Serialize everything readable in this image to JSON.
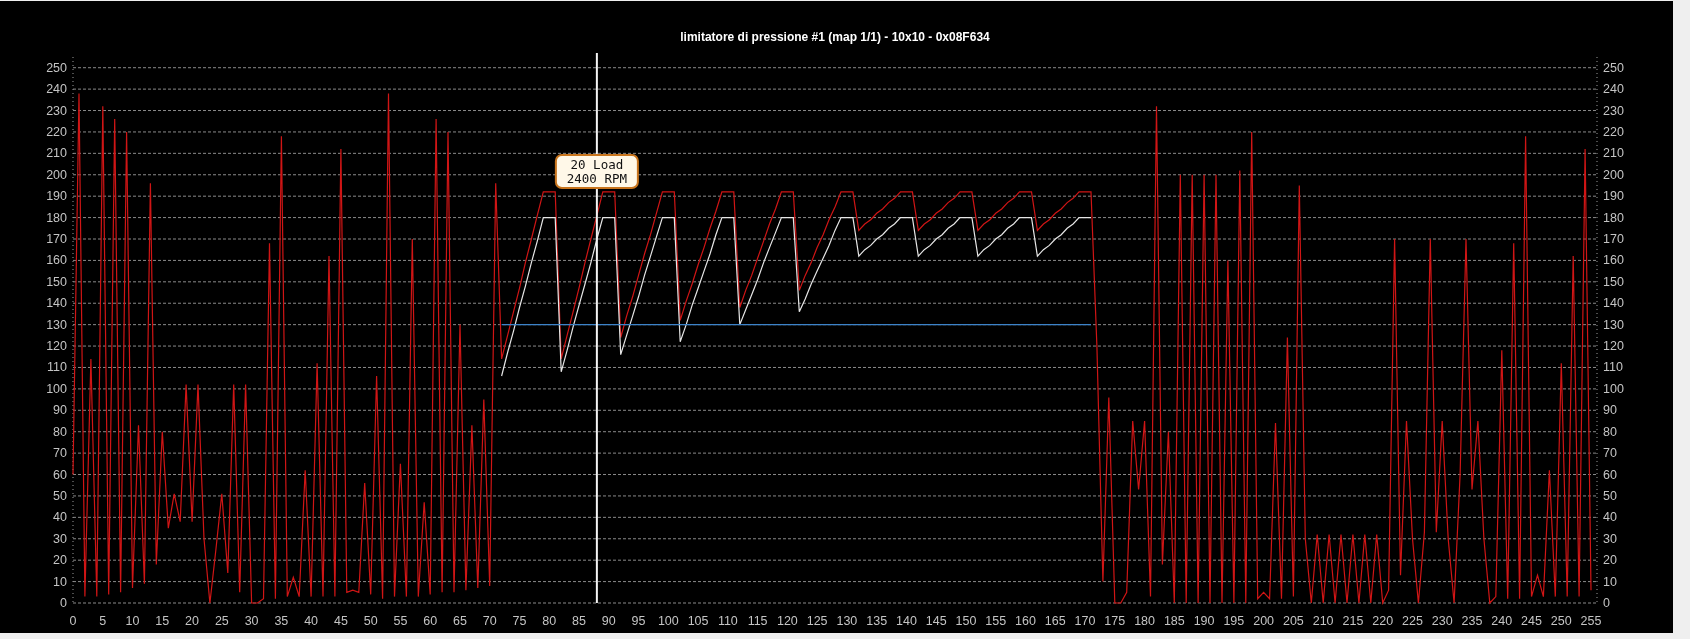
{
  "chart_data": {
    "type": "line",
    "title": "limitatore di pressione #1 (map 1/1) - 10x10 - 0x08F634",
    "grid": true,
    "x": [
      0,
      1,
      2,
      3,
      4,
      5,
      6,
      7,
      8,
      9,
      10,
      11,
      12,
      13,
      14,
      15,
      16,
      17,
      18,
      19,
      20,
      21,
      22,
      23,
      24,
      25,
      26,
      27,
      28,
      29,
      30,
      31,
      32,
      33,
      34,
      35,
      36,
      37,
      38,
      39,
      40,
      41,
      42,
      43,
      44,
      45,
      46,
      47,
      48,
      49,
      50,
      51,
      52,
      53,
      54,
      55,
      56,
      57,
      58,
      59,
      60,
      61,
      62,
      63,
      64,
      65,
      66,
      67,
      68,
      69,
      70,
      71,
      72,
      73,
      74,
      75,
      76,
      77,
      78,
      79,
      80,
      81,
      82,
      83,
      84,
      85,
      86,
      87,
      88,
      89,
      90,
      91,
      92,
      93,
      94,
      95,
      96,
      97,
      98,
      99,
      100,
      101,
      102,
      103,
      104,
      105,
      106,
      107,
      108,
      109,
      110,
      111,
      112,
      113,
      114,
      115,
      116,
      117,
      118,
      119,
      120,
      121,
      122,
      123,
      124,
      125,
      126,
      127,
      128,
      129,
      130,
      131,
      132,
      133,
      134,
      135,
      136,
      137,
      138,
      139,
      140,
      141,
      142,
      143,
      144,
      145,
      146,
      147,
      148,
      149,
      150,
      151,
      152,
      153,
      154,
      155,
      156,
      157,
      158,
      159,
      160,
      161,
      162,
      163,
      164,
      165,
      166,
      167,
      168,
      169,
      170,
      171,
      172,
      173,
      174,
      175,
      176,
      177,
      178,
      179,
      180,
      181,
      182,
      183,
      184,
      185,
      186,
      187,
      188,
      189,
      190,
      191,
      192,
      193,
      194,
      195,
      196,
      197,
      198,
      199,
      200,
      201,
      202,
      203,
      204,
      205,
      206,
      207,
      208,
      209,
      210,
      211,
      212,
      213,
      214,
      215,
      216,
      217,
      218,
      219,
      220,
      221,
      222,
      223,
      224,
      225,
      226,
      227,
      228,
      229,
      230,
      231,
      232,
      233,
      234,
      235,
      236,
      237,
      238,
      239,
      240,
      241,
      242,
      243,
      244,
      245,
      246,
      247,
      248,
      249,
      250,
      251,
      252,
      253,
      254,
      255
    ],
    "xlim": [
      0,
      256
    ],
    "ylim": [
      0,
      255
    ],
    "xticks": [
      0,
      5,
      10,
      15,
      20,
      25,
      30,
      35,
      40,
      45,
      50,
      55,
      60,
      65,
      70,
      75,
      80,
      85,
      90,
      95,
      100,
      105,
      110,
      115,
      120,
      125,
      130,
      135,
      140,
      145,
      150,
      155,
      160,
      165,
      170,
      175,
      180,
      185,
      190,
      195,
      200,
      205,
      210,
      215,
      220,
      225,
      230,
      235,
      240,
      245,
      250,
      255
    ],
    "yticks": [
      0,
      10,
      20,
      30,
      40,
      50,
      60,
      70,
      80,
      90,
      100,
      110,
      120,
      130,
      140,
      150,
      160,
      170,
      180,
      190,
      200,
      210,
      220,
      230,
      240,
      250
    ],
    "series": [
      {
        "color": "#d01515",
        "values": [
          60,
          238,
          3,
          114,
          3,
          232,
          4,
          226,
          5,
          220,
          7,
          83,
          9,
          196,
          18,
          80,
          35,
          51,
          38,
          102,
          38,
          102,
          30,
          0,
          25,
          51,
          14,
          102,
          5,
          102,
          0,
          0,
          2,
          168,
          2,
          218,
          3,
          12,
          3,
          62,
          3,
          112,
          3,
          162,
          3,
          212,
          5,
          6,
          5,
          56,
          4,
          106,
          2,
          238,
          3,
          65,
          3,
          170,
          3,
          47,
          4,
          226,
          5,
          220,
          5,
          130,
          6,
          83,
          7,
          95,
          8,
          196,
          114,
          125,
          136,
          147,
          159,
          170,
          181,
          192,
          192,
          192,
          114,
          125,
          136,
          147,
          159,
          170,
          181,
          192,
          192,
          192,
          124,
          134,
          143,
          153,
          163,
          172,
          182,
          192,
          192,
          192,
          132,
          141,
          149,
          158,
          166,
          175,
          183,
          192,
          192,
          192,
          138,
          146,
          153,
          161,
          169,
          177,
          184,
          192,
          192,
          192,
          146,
          153,
          159,
          166,
          172,
          179,
          185,
          192,
          192,
          192,
          174,
          177,
          179,
          182,
          184,
          187,
          189,
          192,
          192,
          192,
          174,
          177,
          179,
          182,
          184,
          187,
          189,
          192,
          192,
          192,
          174,
          177,
          179,
          182,
          184,
          187,
          189,
          192,
          192,
          192,
          174,
          177,
          179,
          182,
          184,
          187,
          189,
          192,
          192,
          192,
          120,
          10,
          96,
          0,
          0,
          5,
          85,
          53,
          85,
          3,
          232,
          18,
          80,
          0,
          200,
          0,
          200,
          0,
          200,
          0,
          200,
          0,
          160,
          0,
          202,
          0,
          220,
          2,
          5,
          2,
          84,
          2,
          124,
          3,
          195,
          30,
          0,
          32,
          0,
          32,
          0,
          32,
          0,
          32,
          0,
          32,
          0,
          32,
          0,
          6,
          170,
          13,
          85,
          30,
          0,
          33,
          170,
          33,
          85,
          30,
          0,
          60,
          170,
          53,
          85,
          30,
          0,
          3,
          118,
          2,
          168,
          2,
          218,
          3,
          13,
          3,
          62,
          3,
          112,
          3,
          162,
          3,
          212,
          6
        ]
      },
      {
        "color": "#e6e6e6",
        "values": [
          null,
          null,
          null,
          null,
          null,
          null,
          null,
          null,
          null,
          null,
          null,
          null,
          null,
          null,
          null,
          null,
          null,
          null,
          null,
          null,
          null,
          null,
          null,
          null,
          null,
          null,
          null,
          null,
          null,
          null,
          null,
          null,
          null,
          null,
          null,
          null,
          null,
          null,
          null,
          null,
          null,
          null,
          null,
          null,
          null,
          null,
          null,
          null,
          null,
          null,
          null,
          null,
          null,
          null,
          null,
          null,
          null,
          null,
          null,
          null,
          null,
          null,
          null,
          null,
          null,
          null,
          null,
          null,
          null,
          null,
          null,
          null,
          106,
          117,
          127,
          138,
          148,
          159,
          169,
          180,
          180,
          180,
          108,
          118,
          129,
          139,
          149,
          159,
          170,
          180,
          180,
          180,
          116,
          125,
          134,
          143,
          153,
          162,
          171,
          180,
          180,
          180,
          122,
          130,
          139,
          147,
          155,
          163,
          172,
          180,
          180,
          180,
          130,
          137,
          144,
          151,
          159,
          166,
          173,
          180,
          180,
          180,
          136,
          142,
          149,
          155,
          161,
          167,
          174,
          180,
          180,
          180,
          162,
          165,
          167,
          170,
          172,
          175,
          177,
          180,
          180,
          180,
          162,
          165,
          167,
          170,
          172,
          175,
          177,
          180,
          180,
          180,
          162,
          165,
          167,
          170,
          172,
          175,
          177,
          180,
          180,
          180,
          162,
          165,
          167,
          170,
          172,
          175,
          177,
          180,
          180,
          180,
          null,
          null,
          null,
          null,
          null,
          null,
          null,
          null,
          null,
          null,
          null,
          null,
          null,
          null,
          null,
          null,
          null,
          null,
          null,
          null,
          null,
          null,
          null,
          null,
          null,
          null,
          null,
          null,
          null,
          null,
          null,
          null,
          null,
          null,
          null,
          null,
          null,
          null,
          null,
          null,
          null,
          null,
          null,
          null,
          null,
          null,
          null,
          null,
          null,
          null,
          null,
          null,
          null,
          null,
          null,
          null,
          null,
          null,
          null,
          null,
          null,
          null,
          null,
          null,
          null,
          null,
          null,
          null,
          null,
          null,
          null,
          null,
          null,
          null,
          null,
          null,
          null,
          null,
          null,
          null,
          null,
          null,
          null,
          null
        ]
      },
      {
        "color": "#3c82c8",
        "values": [
          null,
          null,
          null,
          null,
          null,
          null,
          null,
          null,
          null,
          null,
          null,
          null,
          null,
          null,
          null,
          null,
          null,
          null,
          null,
          null,
          null,
          null,
          null,
          null,
          null,
          null,
          null,
          null,
          null,
          null,
          null,
          null,
          null,
          null,
          null,
          null,
          null,
          null,
          null,
          null,
          null,
          null,
          null,
          null,
          null,
          null,
          null,
          null,
          null,
          null,
          null,
          null,
          null,
          null,
          null,
          null,
          null,
          null,
          null,
          null,
          null,
          null,
          null,
          null,
          null,
          null,
          null,
          null,
          null,
          null,
          null,
          null,
          130,
          130,
          130,
          130,
          130,
          130,
          130,
          130,
          130,
          130,
          130,
          130,
          130,
          130,
          130,
          130,
          130,
          130,
          130,
          130,
          130,
          130,
          130,
          130,
          130,
          130,
          130,
          130,
          130,
          130,
          130,
          130,
          130,
          130,
          130,
          130,
          130,
          130,
          130,
          130,
          130,
          130,
          130,
          130,
          130,
          130,
          130,
          130,
          130,
          130,
          130,
          130,
          130,
          130,
          130,
          130,
          130,
          130,
          130,
          130,
          130,
          130,
          130,
          130,
          130,
          130,
          130,
          130,
          130,
          130,
          130,
          130,
          130,
          130,
          130,
          130,
          130,
          130,
          130,
          130,
          130,
          130,
          130,
          130,
          130,
          130,
          130,
          130,
          130,
          130,
          130,
          130,
          130,
          130,
          130,
          130,
          130,
          130,
          130,
          130,
          null,
          null,
          null,
          null,
          null,
          null,
          null,
          null,
          null,
          null,
          null,
          null,
          null,
          null,
          null,
          null,
          null,
          null,
          null,
          null,
          null,
          null,
          null,
          null,
          null,
          null,
          null,
          null,
          null,
          null,
          null,
          null,
          null,
          null,
          null,
          null,
          null,
          null,
          null,
          null,
          null,
          null,
          null,
          null,
          null,
          null,
          null,
          null,
          null,
          null,
          null,
          null,
          null,
          null,
          null,
          null,
          null,
          null,
          null,
          null,
          null,
          null,
          null,
          null,
          null,
          null,
          null,
          null,
          null,
          null,
          null,
          null,
          null,
          null,
          null,
          null,
          null,
          null,
          null,
          null,
          null,
          null,
          null,
          null
        ]
      }
    ],
    "ref_lines": [
      {
        "axis": "x",
        "value": 88
      }
    ],
    "annotations": [
      "20 Load\n2400 RPM"
    ]
  },
  "left_axis": {
    "ticks": [
      "250",
      "240",
      "230",
      "220",
      "210",
      "200",
      "190",
      "180",
      "170",
      "160",
      "150",
      "140",
      "130",
      "120",
      "110",
      "100",
      "90",
      "80",
      "70",
      "60",
      "50",
      "40",
      "30",
      "20",
      "10",
      "0"
    ]
  },
  "right_axis": {
    "ticks": [
      "250",
      "240",
      "230",
      "220",
      "210",
      "200",
      "190",
      "180",
      "170",
      "160",
      "150",
      "140",
      "130",
      "120",
      "110",
      "100",
      "90",
      "80",
      "70",
      "60",
      "50",
      "40",
      "30",
      "20",
      "10",
      "0"
    ]
  }
}
